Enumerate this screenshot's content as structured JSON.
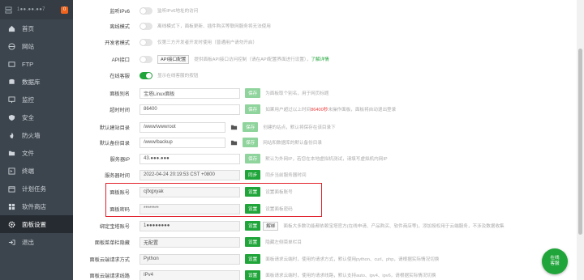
{
  "sidebar": {
    "ip": "1●●.●●.●●7",
    "badge": "0",
    "items": [
      {
        "label": "首页",
        "icon": "home-icon"
      },
      {
        "label": "网站",
        "icon": "globe-icon"
      },
      {
        "label": "FTP",
        "icon": "ftp-icon"
      },
      {
        "label": "数据库",
        "icon": "database-icon"
      },
      {
        "label": "监控",
        "icon": "monitor-icon"
      },
      {
        "label": "安全",
        "icon": "shield-icon"
      },
      {
        "label": "防火墙",
        "icon": "firewall-icon"
      },
      {
        "label": "文件",
        "icon": "folder-icon"
      },
      {
        "label": "终端",
        "icon": "terminal-icon"
      },
      {
        "label": "计划任务",
        "icon": "calendar-icon"
      },
      {
        "label": "软件商店",
        "icon": "store-icon"
      },
      {
        "label": "面板设置",
        "icon": "gear-icon"
      },
      {
        "label": "退出",
        "icon": "logout-icon"
      }
    ]
  },
  "settings": {
    "ipv6": {
      "label": "监听IPv6",
      "hint": "监听IPv6地址的访问"
    },
    "offline": {
      "label": "离线模式",
      "hint": "离线模式下，面板更新、插件购买等联网服务将无法使用"
    },
    "dev": {
      "label": "开发者模式",
      "hint": "仅第三方开发者开发时使用（普通用户请勿开启）"
    },
    "api": {
      "label": "API接口",
      "button": "API接口配置",
      "hint": "提供面板API接口访问控制（请在API配置界面进行设置），",
      "link": "了解详情"
    },
    "cloud_login": {
      "label": "在线客服",
      "hint": "显示在线客服的按钮"
    },
    "panel_alias": {
      "label": "面板别名",
      "value": "宝塔Linux面板",
      "button": "保存",
      "hint": "为面板取个别名，用于网页标题"
    },
    "timeout": {
      "label": "超时时间",
      "value": "86400",
      "button": "保存",
      "hint_pre": "如果用户超过以上时间",
      "hint_red": "86400秒",
      "hint_post": "未操作面板，面板将自动退出登录"
    },
    "default_site": {
      "label": "默认建站目录",
      "value": "/www/wwwroot",
      "button": "保存",
      "hint": "创建的站点，默认将保存在该目录下"
    },
    "default_backup": {
      "label": "默认备份目录",
      "value": "/www/backup",
      "button": "保存",
      "hint": "网站和数据库的默认备份目录"
    },
    "server_ip": {
      "label": "服务器IP",
      "value": "43.●●●.●●●",
      "button": "保存",
      "hint": "默认为外网IP，若您在本地虚拟机测试，请填写虚拟机内网IP"
    },
    "server_time": {
      "label": "服务器时间",
      "value": "2022-04-24 20:19:53 CST +0800",
      "button": "同步",
      "hint": "同步当前服务器时间"
    },
    "panel_user": {
      "label": "面板账号",
      "value": "cjfxgxyak",
      "button": "设置",
      "hint": "设置面板账号"
    },
    "panel_pwd": {
      "label": "面板密码",
      "value": "********",
      "button": "设置",
      "hint": "设置面板密码"
    },
    "bind_account": {
      "label": "绑定宝塔账号",
      "value": "1●●●●●●●●",
      "button1": "设置",
      "button2": "解绑",
      "hint": "面板大多数功能都依赖宝塔官方(在线申请、产品购买、软件商店等)，添加授权用于云端服务，不涉及数据收集"
    },
    "unbind_menu": {
      "label": "面板菜单栏隐藏",
      "value": "无配置",
      "button": "设置",
      "hint": "隐藏左侧菜单栏目"
    },
    "req_method": {
      "label": "面板云端请求方式",
      "value": "Python",
      "button": "设置",
      "hint": "面板请求云端时，使用的请求方式，默认使用python、curl、php，请根据实际情况切换"
    },
    "req_line": {
      "label": "面板云端请求线路",
      "value": "IPv4",
      "button": "设置",
      "hint": "面板请求云端时，使用的请求线路，默认支持auto、ipv4、ipv6，请根据实际情况切换"
    }
  },
  "service": {
    "line1": "在线",
    "line2": "客服"
  },
  "colors": {
    "accent": "#20a53a",
    "sidebar": "#3c444d",
    "highlight": "#e0202a"
  }
}
